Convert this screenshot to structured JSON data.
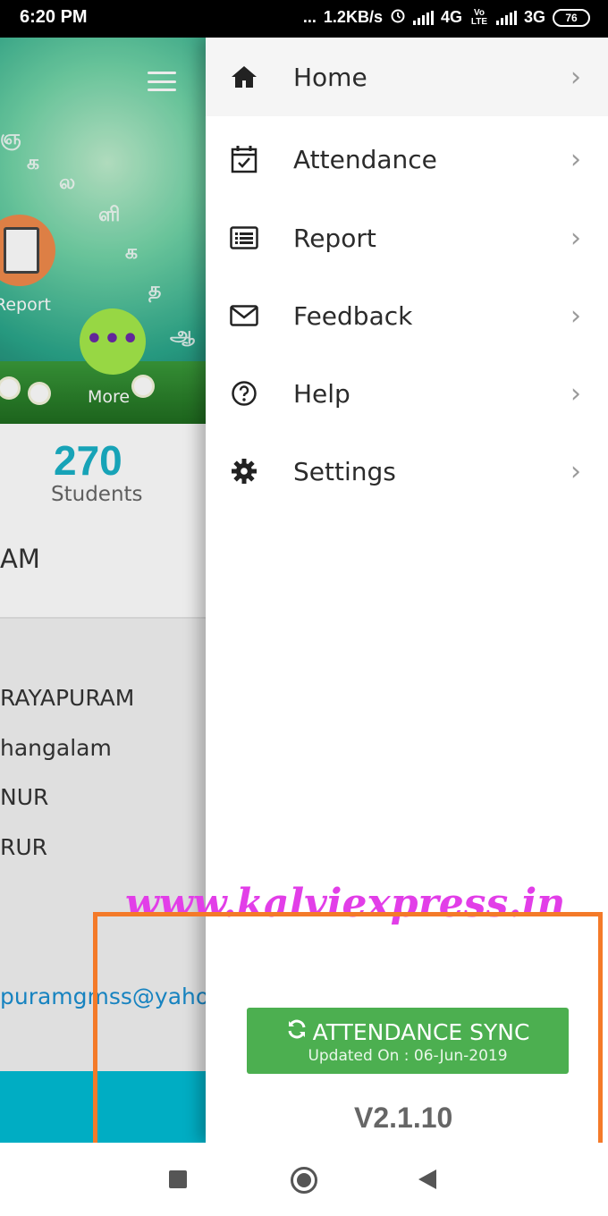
{
  "status_bar": {
    "time": "6:20 PM",
    "dots": "...",
    "speed": "1.2KB/s",
    "net1": "4G",
    "volte": "Vo LTE",
    "net2": "3G",
    "battery": "76"
  },
  "background": {
    "report_label": "Report",
    "more_label": "More",
    "more_dots": "•••",
    "student_count": "270",
    "student_label": "Students",
    "school_fragment": "AM",
    "info_lines": [
      "RAYAPURAM",
      "hangalam",
      "NUR",
      "RUR"
    ],
    "email_fragment": "puramgmss@yaho"
  },
  "drawer": {
    "items": [
      {
        "label": "Home",
        "icon": "home-icon"
      },
      {
        "label": "Attendance",
        "icon": "calendar-check-icon"
      },
      {
        "label": "Report",
        "icon": "list-icon"
      },
      {
        "label": "Feedback",
        "icon": "envelope-icon"
      },
      {
        "label": "Help",
        "icon": "question-circle-icon"
      },
      {
        "label": "Settings",
        "icon": "gear-icon"
      }
    ],
    "chevron": "›",
    "watermark": "www.kalviexpress.in",
    "sync_button": {
      "label": "ATTENDANCE SYNC",
      "subtitle": "Updated On : 06-Jun-2019",
      "icon": "refresh-icon"
    },
    "version": "V2.1.10"
  },
  "colors": {
    "accent_teal": "#19b1c7",
    "sync_green": "#4caf50",
    "highlight_orange": "#f47a29",
    "watermark_magenta": "#e23ee8"
  },
  "nav_bar": {
    "buttons": [
      "recents-button",
      "home-button",
      "back-button"
    ]
  }
}
